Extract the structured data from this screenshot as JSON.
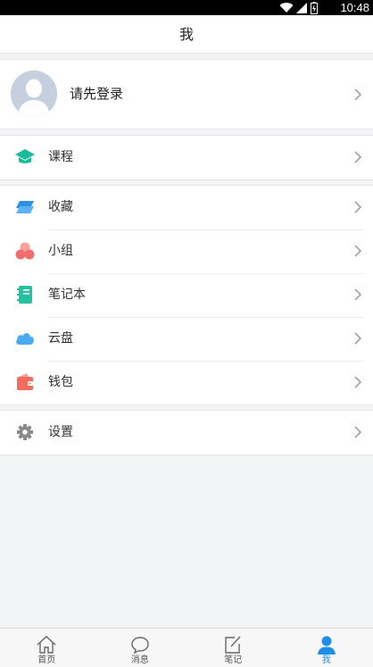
{
  "status_bar": {
    "time": "10:48"
  },
  "header": {
    "title": "我"
  },
  "profile": {
    "login_prompt": "请先登录"
  },
  "menu": {
    "course": {
      "label": "课程",
      "icon": "graduation-cap-icon",
      "color": "#1bbc9b"
    },
    "favorites": {
      "label": "收藏",
      "icon": "stacked-layers-icon",
      "color": "#2f8fe0"
    },
    "group": {
      "label": "小组",
      "icon": "circles-cluster-icon",
      "color": "#f26d6d"
    },
    "notebook": {
      "label": "笔记本",
      "icon": "notebook-icon",
      "color": "#24c1a5"
    },
    "cloud": {
      "label": "云盘",
      "icon": "cloud-icon",
      "color": "#4aaaf0"
    },
    "wallet": {
      "label": "钱包",
      "icon": "wallet-icon",
      "color": "#f36d5f"
    },
    "settings": {
      "label": "设置",
      "icon": "gear-icon",
      "color": "#8a8a8a"
    }
  },
  "tabbar": {
    "home": {
      "label": "首页",
      "icon": "home-icon"
    },
    "messages": {
      "label": "消息",
      "icon": "chat-bubble-icon"
    },
    "notes": {
      "label": "笔记",
      "icon": "edit-note-icon"
    },
    "me": {
      "label": "我",
      "icon": "person-icon",
      "active": true,
      "color": "#1e8fe8"
    }
  }
}
